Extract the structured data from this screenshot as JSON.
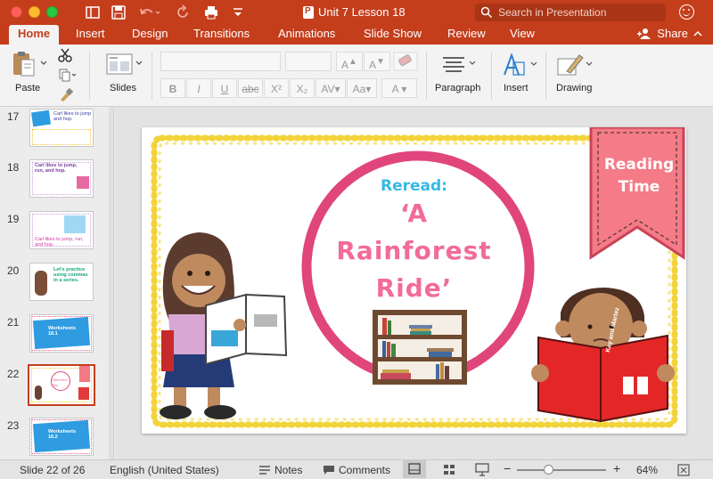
{
  "window": {
    "title": "Unit 7 Lesson 18",
    "search_placeholder": "Search in Presentation",
    "accent": "#c43e1c"
  },
  "tabs": [
    {
      "label": "Home",
      "active": true
    },
    {
      "label": "Insert"
    },
    {
      "label": "Design"
    },
    {
      "label": "Transitions"
    },
    {
      "label": "Animations"
    },
    {
      "label": "Slide Show"
    },
    {
      "label": "Review"
    },
    {
      "label": "View"
    }
  ],
  "share_label": "Share",
  "ribbon": {
    "paste": "Paste",
    "slides": "Slides",
    "paragraph": "Paragraph",
    "insert": "Insert",
    "drawing": "Drawing",
    "format_buttons": [
      "B",
      "I",
      "U",
      "abc",
      "X²",
      "X₂"
    ]
  },
  "thumbnails": [
    {
      "number": "17",
      "text": "Carl likes to jump and hop."
    },
    {
      "number": "18",
      "text": "Carl likes to jump, run, and hop."
    },
    {
      "number": "19",
      "text": "Carl likes to jump, run, and hop."
    },
    {
      "number": "20",
      "text": "Let's practice using commas in a series."
    },
    {
      "number": "21",
      "text": "Worksheets 18.1"
    },
    {
      "number": "22",
      "text": "Rainforest Ride",
      "selected": true
    },
    {
      "number": "23",
      "text": "Worksheets 18.2"
    }
  ],
  "slide": {
    "subtitle": "Reread:",
    "title_line1": "‘A",
    "title_line2": "Rainforest",
    "title_line3": "Ride’",
    "banner_line1": "Reading",
    "banner_line2": "Time",
    "book_title": "Kay and Martez"
  },
  "status": {
    "slide_position": "Slide 22 of 26",
    "language": "English (United States)",
    "notes": "Notes",
    "comments": "Comments",
    "zoom": "64%",
    "zoom_fraction": 0.35
  }
}
